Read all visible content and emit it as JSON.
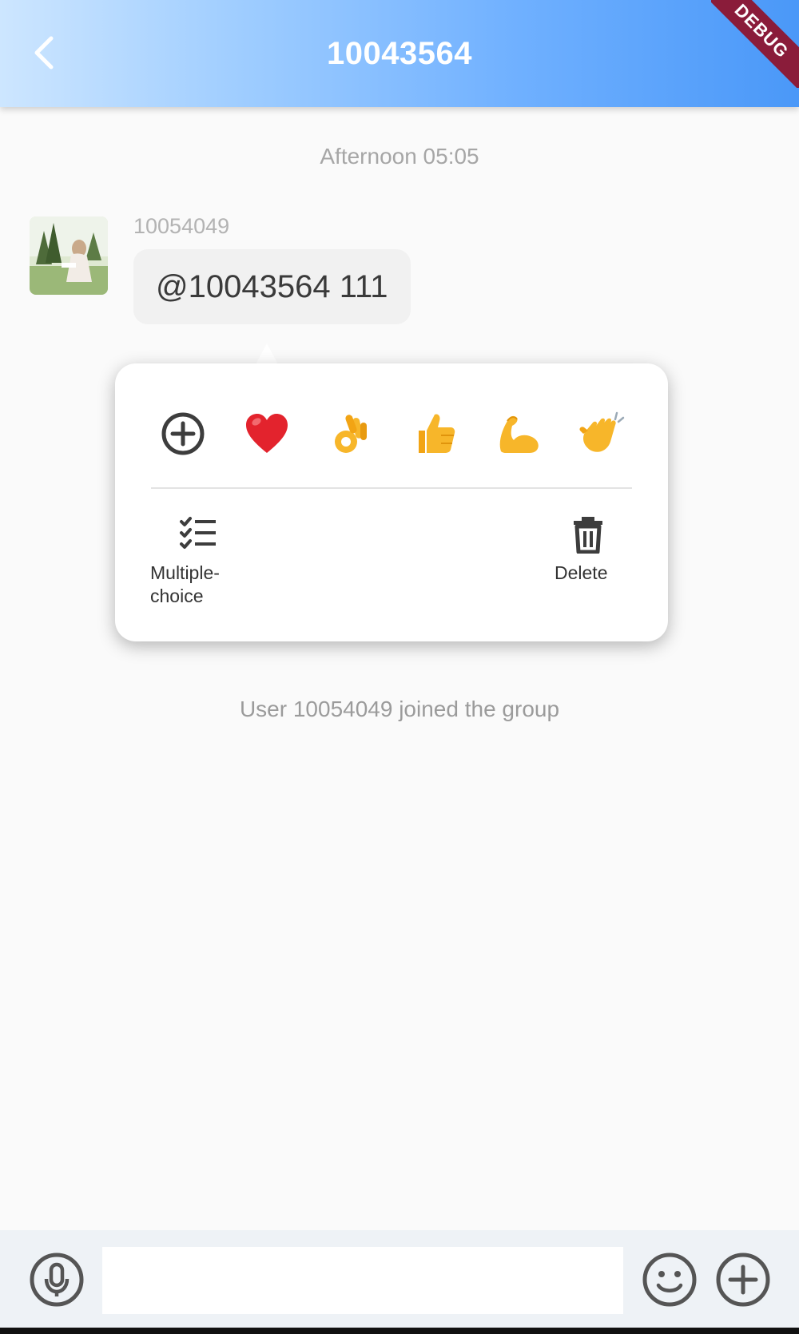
{
  "app_bar": {
    "title": "10043564",
    "back_icon": "chevron-left-icon",
    "debug_banner": "DEBUG",
    "colors": {
      "gradient_start": "#cde6ff",
      "gradient_end": "#4a98f8",
      "banner": "#8a1c3a"
    }
  },
  "chat": {
    "timestamp": "Afternoon 05:05",
    "message": {
      "sender": "10054049",
      "text": "@10043564 111",
      "avatar_icon": "user-avatar-photo"
    },
    "system_message": "User 10054049 joined the group"
  },
  "context_menu": {
    "reactions": [
      {
        "icon": "add-reaction-icon"
      },
      {
        "icon": "heart-icon"
      },
      {
        "icon": "ok-hand-icon"
      },
      {
        "icon": "thumbs-up-icon"
      },
      {
        "icon": "flexed-biceps-icon"
      },
      {
        "icon": "clapping-hands-icon"
      }
    ],
    "actions": {
      "multiple_choice": {
        "label": "Multiple-\nchoice",
        "icon": "checklist-icon"
      },
      "delete": {
        "label": "Delete",
        "icon": "trash-icon"
      }
    }
  },
  "input_bar": {
    "voice_icon": "microphone-icon",
    "emoji_icon": "smiley-icon",
    "plus_icon": "plus-icon",
    "input_value": ""
  }
}
